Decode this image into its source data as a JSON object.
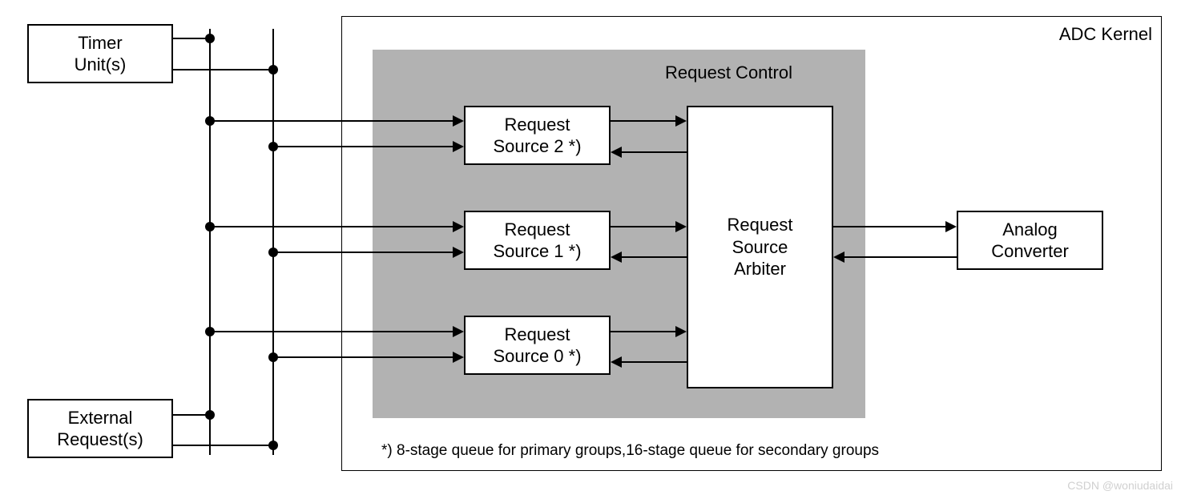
{
  "left_boxes": {
    "timer": {
      "line1": "Timer",
      "line2": "Unit(s)"
    },
    "external": {
      "line1": "External",
      "line2": "Request(s)"
    }
  },
  "kernel_label": "ADC Kernel",
  "request_control_label": "Request Control",
  "request_sources": {
    "rs2": {
      "line1": "Request",
      "line2": "Source 2 *)"
    },
    "rs1": {
      "line1": "Request",
      "line2": "Source 1 *)"
    },
    "rs0": {
      "line1": "Request",
      "line2": "Source 0 *)"
    }
  },
  "arbiter": {
    "line1": "Request",
    "line2": "Source",
    "line3": "Arbiter"
  },
  "analog_converter": {
    "line1": "Analog",
    "line2": "Converter"
  },
  "footnote": "*) 8-stage queue for primary groups,16-stage queue for secondary groups",
  "watermark": "CSDN @woniudaidai"
}
